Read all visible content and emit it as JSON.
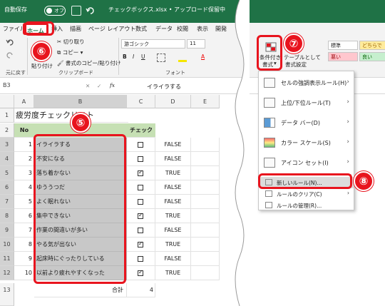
{
  "titlebar": {
    "autosave_label": "自動保存",
    "autosave_state": "オフ",
    "filename": "チェックボックス.xlsx • アップロード保留中"
  },
  "menu": {
    "tabs": [
      "ファイル",
      "ホーム",
      "挿入",
      "描画",
      "ページ レイアウト",
      "数式",
      "データ",
      "校閲",
      "表示",
      "開発"
    ],
    "active_tab": "ホーム"
  },
  "ribbon": {
    "undo_group": "元に戻す",
    "paste": "貼り付け",
    "cut": "切り取り",
    "copy": "コピー",
    "format_painter": "書式のコピー/貼り付け",
    "clipboard_group": "クリップボード",
    "font_name": "游ゴシック",
    "font_size": "11",
    "font_group": "フォント",
    "cond_format_line1": "条件付き",
    "cond_format_line2": "書式",
    "table_format_line1": "テーブルとして",
    "table_format_line2": "書式設定",
    "styles": [
      "標準",
      "どちらで",
      "悪い",
      "良い"
    ]
  },
  "formula_bar": {
    "name_box": "B3",
    "fx": "fx",
    "content": "イライラする"
  },
  "sheet": {
    "columns": [
      "A",
      "B",
      "C",
      "D",
      "E"
    ],
    "title": "疲労度チェックリスト",
    "header_no": "No",
    "header_check": "チェック",
    "rows": [
      {
        "no": "1",
        "item": "イライラする",
        "checked": false,
        "value": "FALSE"
      },
      {
        "no": "2",
        "item": "不安になる",
        "checked": false,
        "value": "FALSE"
      },
      {
        "no": "3",
        "item": "落ち着かない",
        "checked": true,
        "value": "TRUE"
      },
      {
        "no": "4",
        "item": "ゆううつだ",
        "checked": false,
        "value": "FALSE"
      },
      {
        "no": "5",
        "item": "よく眠れない",
        "checked": false,
        "value": "FALSE"
      },
      {
        "no": "6",
        "item": "集中できない",
        "checked": true,
        "value": "TRUE"
      },
      {
        "no": "7",
        "item": "作業の間違いが多い",
        "checked": false,
        "value": "FALSE"
      },
      {
        "no": "8",
        "item": "やる気が出ない",
        "checked": true,
        "value": "TRUE"
      },
      {
        "no": "9",
        "item": "起床時にぐったりしている",
        "checked": false,
        "value": "FALSE"
      },
      {
        "no": "10",
        "item": "以前より疲れやすくなった",
        "checked": true,
        "value": "TRUE"
      }
    ],
    "row_numbers": [
      "1",
      "2",
      "3",
      "4",
      "5",
      "6",
      "7",
      "8",
      "9",
      "10",
      "11",
      "12",
      "13"
    ],
    "total_label": "合計",
    "total_value": "4"
  },
  "dropdown": {
    "items": [
      {
        "label": "セルの強調表示ルール(H)",
        "icon": "highlight-rules-icon"
      },
      {
        "label": "上位/下位ルール(T)",
        "icon": "top-bottom-icon"
      },
      {
        "label": "データ バー(D)",
        "icon": "data-bar-icon"
      },
      {
        "label": "カラー スケール(S)",
        "icon": "color-scale-icon"
      },
      {
        "label": "アイコン セット(I)",
        "icon": "icon-set-icon"
      }
    ],
    "new_rule": "新しいルール(N)...",
    "clear_rules": "ルールのクリア(C)",
    "manage_rules": "ルールの管理(R)..."
  },
  "callouts": {
    "c5": "⑤",
    "c6": "⑥",
    "c7": "⑦",
    "c8": "⑧"
  },
  "colors": {
    "excel_green": "#1f7246",
    "callout_red": "#e8141e",
    "selection": "#c8c8c8"
  }
}
